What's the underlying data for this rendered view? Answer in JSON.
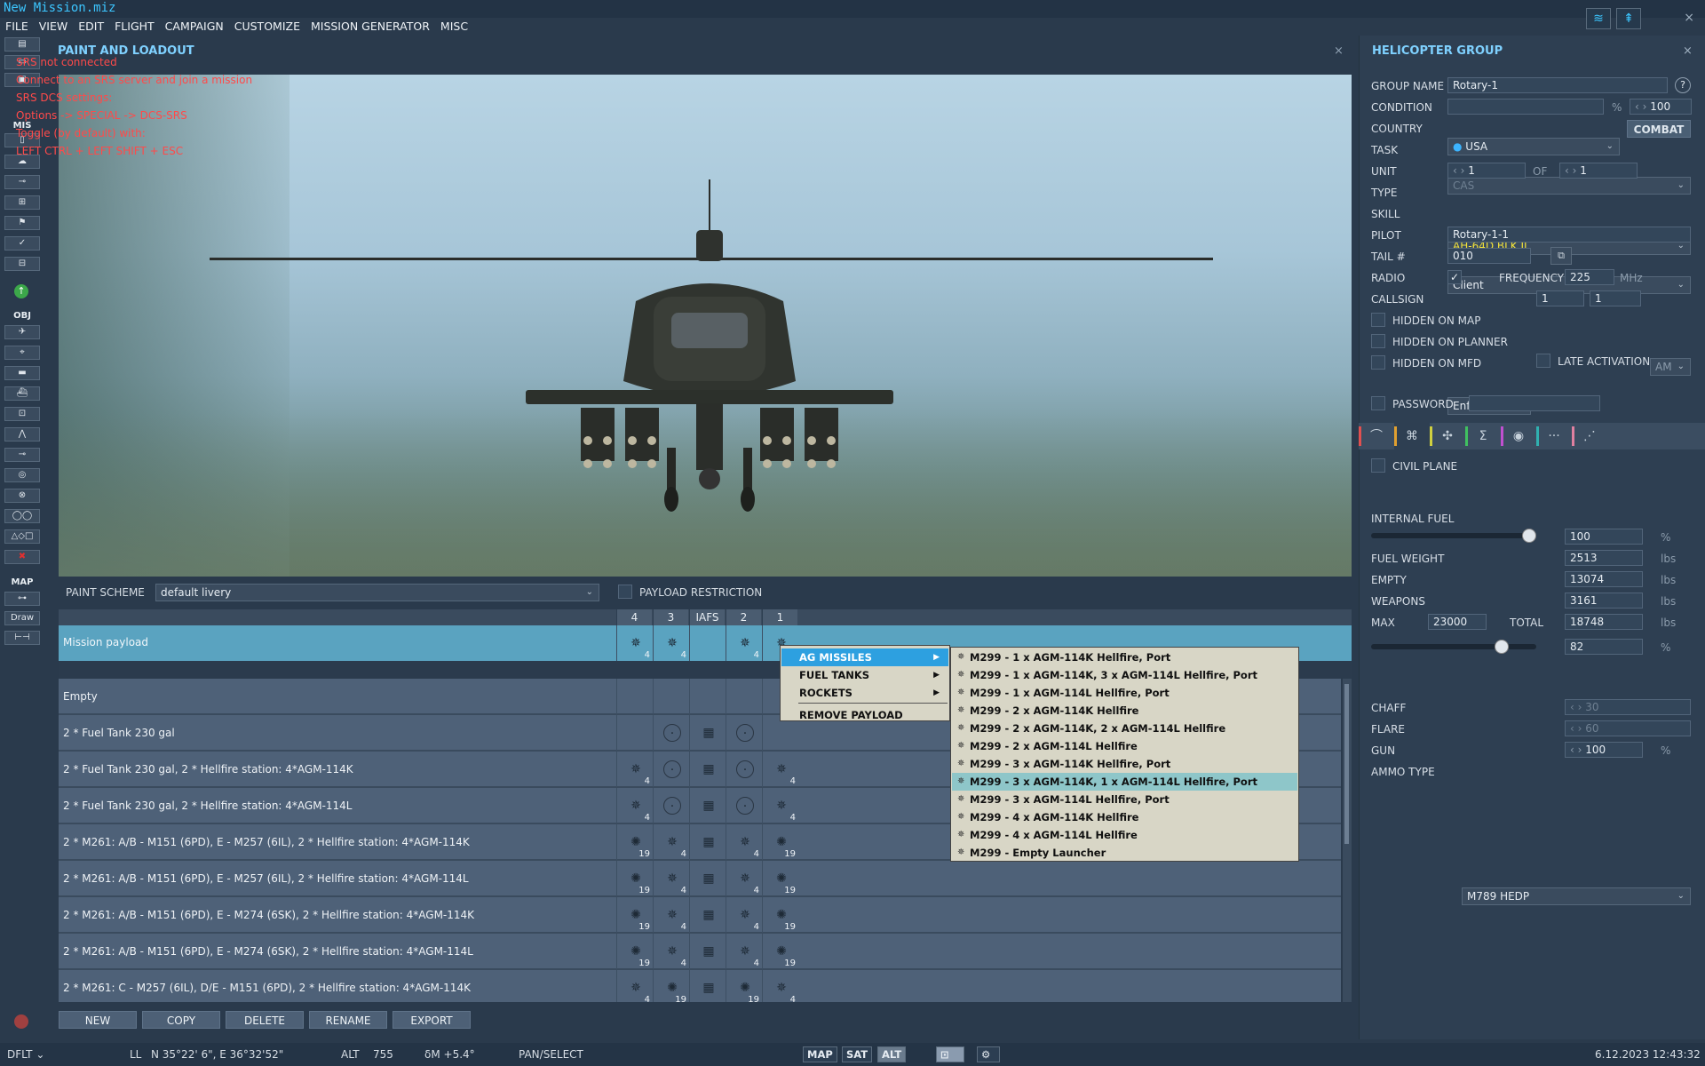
{
  "app": {
    "title": "New Mission.miz",
    "menu": [
      "FILE",
      "VIEW",
      "EDIT",
      "FLIGHT",
      "CAMPAIGN",
      "CUSTOMIZE",
      "MISSION GENERATOR",
      "MISC"
    ],
    "top_icons": [
      "wifi-icon",
      "antenna-icon"
    ],
    "close": "×"
  },
  "left_toolbar": {
    "labels": {
      "mis": "MIS",
      "obj": "OBJ",
      "map": "MAP"
    },
    "draw": "Draw"
  },
  "srs": {
    "lines": [
      "SRS not connected",
      "Connect to an SRS server and join a mission",
      "SRS DCS settings:",
      "Options -> SPECIAL -> DCS-SRS",
      "Toggle (by default) with:",
      "LEFT CTRL + LEFT SHIFT + ESC"
    ]
  },
  "paint_loadout": {
    "title": "PAINT AND LOADOUT",
    "close": "×",
    "paint_scheme_label": "PAINT SCHEME",
    "paint_scheme_value": "default livery",
    "payload_restriction_label": "PAYLOAD RESTRICTION",
    "columns": [
      "4",
      "3",
      "IAFS",
      "2",
      "1"
    ],
    "mission_payload": {
      "name": "Mission payload",
      "cells": [
        {
          "icon": "✵",
          "count": "4"
        },
        {
          "icon": "✵",
          "count": "4"
        },
        {
          "icon": "",
          "count": ""
        },
        {
          "icon": "✵",
          "count": "4"
        },
        {
          "icon": "✵",
          "count": ""
        }
      ]
    },
    "rows": [
      {
        "name": "Empty",
        "cells": [
          {
            "icon": "",
            "count": ""
          },
          {
            "icon": "",
            "count": ""
          },
          {
            "icon": "",
            "count": ""
          },
          {
            "icon": "",
            "count": ""
          },
          {
            "icon": "",
            "count": ""
          }
        ]
      },
      {
        "name": "2 * Fuel Tank 230 gal",
        "cells": [
          {
            "icon": "",
            "count": ""
          },
          {
            "icon": "·",
            "count": "",
            "round": true
          },
          {
            "icon": "▦",
            "count": ""
          },
          {
            "icon": "·",
            "count": "",
            "round": true
          },
          {
            "icon": "",
            "count": ""
          }
        ]
      },
      {
        "name": "2 * Fuel Tank 230 gal, 2 * Hellfire station: 4*AGM-114K",
        "cells": [
          {
            "icon": "✵",
            "count": "4"
          },
          {
            "icon": "·",
            "count": "",
            "round": true
          },
          {
            "icon": "▦",
            "count": ""
          },
          {
            "icon": "·",
            "count": "",
            "round": true
          },
          {
            "icon": "✵",
            "count": "4"
          }
        ]
      },
      {
        "name": "2 * Fuel Tank 230 gal, 2 * Hellfire station: 4*AGM-114L",
        "cells": [
          {
            "icon": "✵",
            "count": "4"
          },
          {
            "icon": "·",
            "count": "",
            "round": true
          },
          {
            "icon": "▦",
            "count": ""
          },
          {
            "icon": "·",
            "count": "",
            "round": true
          },
          {
            "icon": "✵",
            "count": "4"
          }
        ]
      },
      {
        "name": "2 * M261: A/B - M151 (6PD), E - M257 (6IL), 2 * Hellfire station: 4*AGM-114K",
        "cells": [
          {
            "icon": "✺",
            "count": "19"
          },
          {
            "icon": "✵",
            "count": "4"
          },
          {
            "icon": "▦",
            "count": ""
          },
          {
            "icon": "✵",
            "count": "4"
          },
          {
            "icon": "✺",
            "count": "19"
          }
        ]
      },
      {
        "name": "2 * M261: A/B - M151 (6PD), E - M257 (6IL), 2 * Hellfire station: 4*AGM-114L",
        "cells": [
          {
            "icon": "✺",
            "count": "19"
          },
          {
            "icon": "✵",
            "count": "4"
          },
          {
            "icon": "▦",
            "count": ""
          },
          {
            "icon": "✵",
            "count": "4"
          },
          {
            "icon": "✺",
            "count": "19"
          }
        ]
      },
      {
        "name": "2 * M261: A/B - M151 (6PD), E - M274 (6SK), 2 * Hellfire station: 4*AGM-114K",
        "cells": [
          {
            "icon": "✺",
            "count": "19"
          },
          {
            "icon": "✵",
            "count": "4"
          },
          {
            "icon": "▦",
            "count": ""
          },
          {
            "icon": "✵",
            "count": "4"
          },
          {
            "icon": "✺",
            "count": "19"
          }
        ]
      },
      {
        "name": "2 * M261: A/B - M151 (6PD), E - M274 (6SK), 2 * Hellfire station: 4*AGM-114L",
        "cells": [
          {
            "icon": "✺",
            "count": "19"
          },
          {
            "icon": "✵",
            "count": "4"
          },
          {
            "icon": "▦",
            "count": ""
          },
          {
            "icon": "✵",
            "count": "4"
          },
          {
            "icon": "✺",
            "count": "19"
          }
        ]
      },
      {
        "name": "2 * M261: C - M257 (6IL), D/E - M151 (6PD), 2 * Hellfire station: 4*AGM-114K",
        "cells": [
          {
            "icon": "✵",
            "count": "4"
          },
          {
            "icon": "✺",
            "count": "19"
          },
          {
            "icon": "▦",
            "count": ""
          },
          {
            "icon": "✺",
            "count": "19"
          },
          {
            "icon": "✵",
            "count": "4"
          }
        ]
      }
    ],
    "buttons": [
      "NEW",
      "COPY",
      "DELETE",
      "RENAME",
      "EXPORT"
    ]
  },
  "context_menu": {
    "items": [
      {
        "label": "AG MISSILES",
        "has_sub": true,
        "highlight": true
      },
      {
        "label": "FUEL TANKS",
        "has_sub": true
      },
      {
        "label": "ROCKETS",
        "has_sub": true
      },
      {
        "label": "REMOVE PAYLOAD",
        "has_sub": false
      }
    ],
    "submenu": [
      "M299 - 1 x AGM-114K Hellfire, Port",
      "M299 - 1 x AGM-114K, 3 x AGM-114L Hellfire, Port",
      "M299 - 1 x AGM-114L Hellfire, Port",
      "M299 - 2 x AGM-114K Hellfire",
      "M299 - 2 x AGM-114K, 2 x AGM-114L Hellfire",
      "M299 - 2 x AGM-114L Hellfire",
      "M299 - 3 x AGM-114K Hellfire, Port",
      "M299 - 3 x AGM-114K, 1 x AGM-114L Hellfire, Port",
      "M299 - 3 x AGM-114L Hellfire, Port",
      "M299 - 4 x AGM-114K Hellfire",
      "M299 - 4 x AGM-114L Hellfire",
      "M299 - Empty Launcher"
    ],
    "submenu_highlight_index": 7
  },
  "group": {
    "title": "HELICOPTER GROUP",
    "close": "×",
    "group_name_label": "GROUP NAME",
    "group_name": "Rotary-1",
    "help": "?",
    "condition_label": "CONDITION",
    "condition_unit": "%",
    "condition_value": "100",
    "country_label": "COUNTRY",
    "country": "USA",
    "combat": "COMBAT",
    "task_label": "TASK",
    "task": "CAS",
    "unit_label": "UNIT",
    "unit": "1",
    "of_label": "OF",
    "unit_of": "1",
    "type_label": "TYPE",
    "type": "AH-64D BLK.II",
    "skill_label": "SKILL",
    "skill": "Client",
    "pilot_label": "PILOT",
    "pilot": "Rotary-1-1",
    "tail_label": "TAIL #",
    "tail": "010",
    "radio_label": "RADIO",
    "frequency_label": "FREQUENCY",
    "frequency": "225",
    "mhz": "MHz",
    "modulation": "AM",
    "callsign_label": "CALLSIGN",
    "callsign": "Enfield",
    "callsign_1": "1",
    "callsign_2": "1",
    "hidden_map": "HIDDEN ON MAP",
    "hidden_planner": "HIDDEN ON PLANNER",
    "hidden_mfd": "HIDDEN ON MFD",
    "late_activation": "LATE ACTIVATION",
    "password": "PASSWORD",
    "tabs": [
      "route-icon",
      "loadout-icon",
      "rotor-icon",
      "sum-icon",
      "radio-icon",
      "more-icon",
      "extra-icon"
    ],
    "tab_glyphs": [
      "⌒",
      "⌘",
      "✣",
      "Σ",
      "◉",
      "···",
      "⋰"
    ],
    "tab_colors": [
      "#e05050",
      "#e0a030",
      "#d0d040",
      "#40c060",
      "#c050d0",
      "#30b0b0",
      "#e080a0"
    ],
    "civil_plane": "CIVIL PLANE",
    "internal_fuel_label": "INTERNAL FUEL",
    "internal_fuel": "100",
    "pct": "%",
    "internal_fuel_fraction": 1.0,
    "fuel_weight_label": "FUEL WEIGHT",
    "fuel_weight": "2513",
    "empty_label": "EMPTY",
    "empty": "13074",
    "weapons_label": "WEAPONS",
    "weapons": "3161",
    "max_label": "MAX",
    "max": "23000",
    "total_label": "TOTAL",
    "total": "18748",
    "lbs": "lbs",
    "load_pct": "82",
    "load_fraction": 0.82,
    "chaff_label": "CHAFF",
    "chaff": "30",
    "flare_label": "FLARE",
    "flare": "60",
    "gun_label": "GUN",
    "gun": "100",
    "ammo_label": "AMMO TYPE",
    "ammo": "M789 HEDP"
  },
  "status": {
    "mode": "DFLT",
    "ll_label": "LL",
    "ll": "N 35°22' 6\", E 36°32'52\"",
    "alt_label": "ALT",
    "alt": "755",
    "dm": "δM  +5.4°",
    "tool": "PAN/SELECT",
    "map": "MAP",
    "sat": "SAT",
    "alt_btn": "ALT",
    "datetime": "6.12.2023 12:43:32"
  }
}
